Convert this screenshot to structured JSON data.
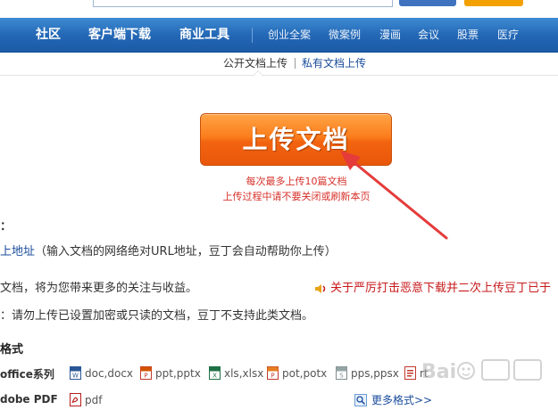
{
  "nav": {
    "main": [
      "社区",
      "客户端下载",
      "商业工具"
    ],
    "sub": [
      "创业全案",
      "微案例",
      "漫画",
      "会议",
      "股票",
      "医疗"
    ]
  },
  "subtabs": {
    "public": "公开文档上传",
    "private": "私有文档上传"
  },
  "upload": {
    "button_label": "上传文档",
    "note1": "每次最多上传10篇文档",
    "note2": "上传过程中请不要关闭或刷新本页"
  },
  "info": {
    "colon": "：",
    "url_link": "上地址",
    "url_desc": "（输入文档的网络绝对URL地址，豆丁会自动帮助你上传）",
    "benefit": "文档，将为您带来更多的关注与收益。",
    "warn_link": "关于严厉打击恶意下载并二次上传豆丁已于",
    "encrypt": "：请勿上传已设置加密或只读的文档，豆丁不支持此类文档。"
  },
  "formats": {
    "title": "格式",
    "office_label": "office系列",
    "pdf_label": "dobe PDF",
    "items": [
      "doc,docx",
      "ppt,pptx",
      "xls,xlsx",
      "pot,potx",
      "pps,ppsx",
      "rt"
    ],
    "pdf_item": "pdf",
    "more": "更多格式>>"
  },
  "colors": {
    "nav_blue": "#2468b6",
    "button_orange": "#f26410",
    "note_red": "#d6312b",
    "link_blue": "#1a4c9c",
    "arrow_red": "#e53b3b"
  },
  "icons": [
    "word-icon",
    "ppt-icon",
    "excel-icon",
    "pot-icon",
    "pps-icon",
    "rtf-icon",
    "pdf-icon",
    "speaker-icon",
    "more-formats-icon"
  ]
}
